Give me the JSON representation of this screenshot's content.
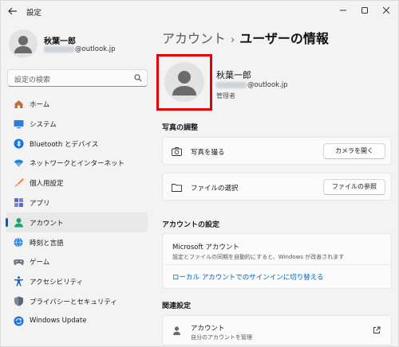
{
  "window": {
    "title": "設定",
    "controls": {
      "minimize": "minimize-icon",
      "maximize": "maximize-icon",
      "close": "close-icon"
    }
  },
  "sidebar": {
    "profile": {
      "name": "秋葉一郎",
      "email_domain": "@outlook.jp"
    },
    "search": {
      "placeholder": "設定の検索"
    },
    "items": [
      {
        "label": "ホーム",
        "icon": "home-icon"
      },
      {
        "label": "システム",
        "icon": "system-icon"
      },
      {
        "label": "Bluetooth とデバイス",
        "icon": "bluetooth-icon"
      },
      {
        "label": "ネットワークとインターネット",
        "icon": "wifi-icon"
      },
      {
        "label": "個人用設定",
        "icon": "brush-icon"
      },
      {
        "label": "アプリ",
        "icon": "apps-icon"
      },
      {
        "label": "アカウント",
        "icon": "account-icon",
        "active": true
      },
      {
        "label": "時刻と言語",
        "icon": "globe-clock-icon"
      },
      {
        "label": "ゲーム",
        "icon": "gamepad-icon"
      },
      {
        "label": "アクセシビリティ",
        "icon": "accessibility-icon"
      },
      {
        "label": "プライバシーとセキュリティ",
        "icon": "shield-icon"
      },
      {
        "label": "Windows Update",
        "icon": "update-icon"
      }
    ]
  },
  "main": {
    "breadcrumb": {
      "parent": "アカウント",
      "separator": "›",
      "current": "ユーザーの情報"
    },
    "user": {
      "name": "秋葉一郎",
      "email_domain": "@outlook.jp",
      "role": "管理者"
    },
    "photo_section": {
      "title": "写真の調整",
      "take_photo": {
        "label": "写真を撮る",
        "button": "カメラを開く"
      },
      "choose_file": {
        "label": "ファイルの選択",
        "button": "ファイルの参照"
      }
    },
    "account_section": {
      "title": "アカウントの設定",
      "ms_title": "Microsoft アカウント",
      "ms_desc": "設定とファイルの同期を自動的にすると、Windows が改善されます",
      "local_link": "ローカル アカウントでのサインインに切り替える"
    },
    "related_section": {
      "title": "関連設定",
      "accounts_title": "アカウント",
      "accounts_desc": "自分のアカウントを管理"
    }
  },
  "colors": {
    "accent": "#005fb8",
    "highlight_border": "#e00000",
    "background": "#f3f3f3",
    "card": "#fbfbfb"
  }
}
